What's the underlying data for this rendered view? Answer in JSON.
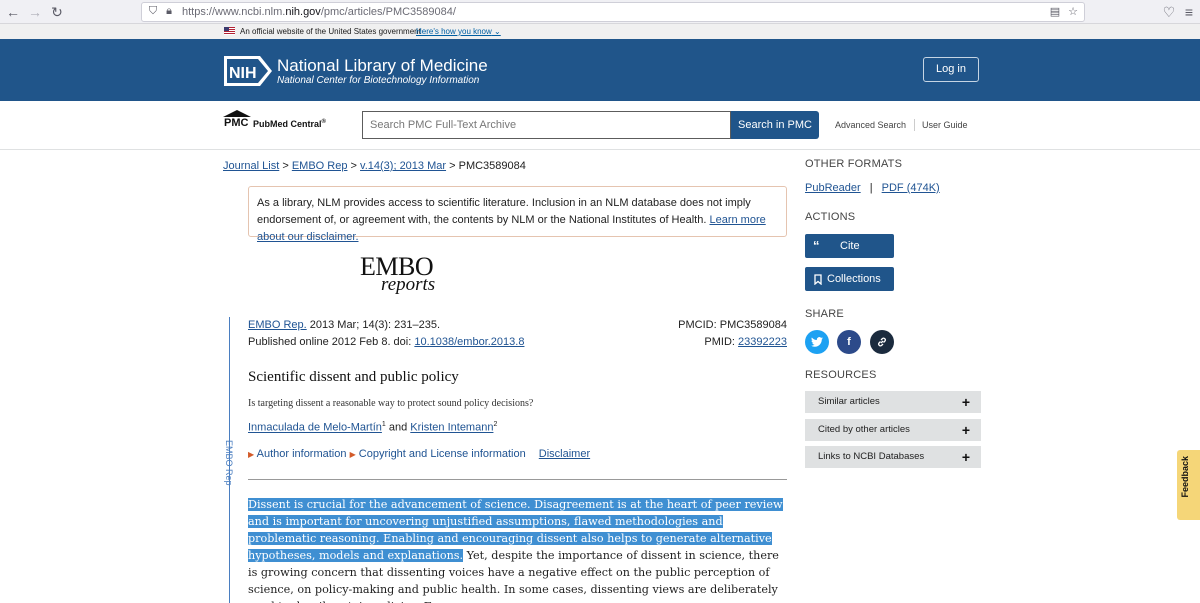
{
  "browser": {
    "url_prefix": "https://www.ncbi.nlm.",
    "url_domain": "nih.gov",
    "url_path": "/pmc/articles/PMC3589084/"
  },
  "gov_banner": {
    "text": "An official website of the United States government",
    "how": "Here's how you know"
  },
  "nlm": {
    "logo": "NIH",
    "title": "National Library of Medicine",
    "subtitle": "National Center for Biotechnology Information",
    "login": "Log in"
  },
  "pmc": {
    "logo_short": "PMC",
    "logo_full": "PubMed Central",
    "logo_mark": "®",
    "search_placeholder": "Search PMC Full-Text Archive",
    "search_button": "Search in PMC",
    "advanced": "Advanced Search",
    "guide": "User Guide"
  },
  "breadcrumb": {
    "journal_list": "Journal List",
    "journal": "EMBO Rep",
    "volume": "v.14(3); 2013 Mar",
    "current": "PMC3589084",
    "sep": ">"
  },
  "disclaimer": {
    "text": "As a library, NLM provides access to scientific literature. Inclusion in an NLM database does not imply endorsement of, or agreement with, the contents by NLM or the National Institutes of Health.",
    "link": "Learn more about our disclaimer."
  },
  "journal_logo": {
    "line1": "EMBO",
    "line2": "reports"
  },
  "citation": {
    "journal": "EMBO Rep.",
    "issue": "2013 Mar; 14(3): 231–235.",
    "published": "Published online 2012 Feb 8. doi:",
    "doi": "10.1038/embor.2013.8",
    "pmcid": "PMCID: PMC3589084",
    "pmid_label": "PMID:",
    "pmid": "23392223",
    "side_label": "EMBO Rep"
  },
  "article": {
    "title": "Scientific dissent and public policy",
    "subtitle": "Is targeting dissent a reasonable way to protect sound policy decisions?",
    "author1": "Inmaculada de Melo-Martín",
    "author1_sup": "1",
    "and": "and",
    "author2": "Kristen Intemann",
    "author2_sup": "2",
    "author_info": "Author information",
    "copyright": "Copyright and License information",
    "disclaimer_link": "Disclaimer",
    "highlighted_text": "Dissent is crucial for the advancement of science. Disagreement is at the heart of peer review and is important for uncovering unjustified assumptions, flawed methodologies and problematic reasoning. Enabling and encouraging dissent also helps to generate alternative hypotheses, models and explanations.",
    "body_text": " Yet, despite the importance of dissent in science, there is growing concern that dissenting voices have a negative effect on the public perception of science, on policy-making and public health. In some cases, dissenting views are deliberately used to derail certain policies. For"
  },
  "sidebar": {
    "other_formats": "OTHER FORMATS",
    "pubreader": "PubReader",
    "pipe": "|",
    "pdf": "PDF (474K)",
    "actions": "ACTIONS",
    "cite": "Cite",
    "collections": "Collections",
    "share": "SHARE",
    "resources": "RESOURCES",
    "similar": "Similar articles",
    "cited_by": "Cited by other articles",
    "links_ncbi": "Links to NCBI Databases",
    "twitter_color": "#1da1f2",
    "facebook_color": "#2c4a8a",
    "link_color": "#1b2b3e"
  },
  "feedback": "Feedback"
}
